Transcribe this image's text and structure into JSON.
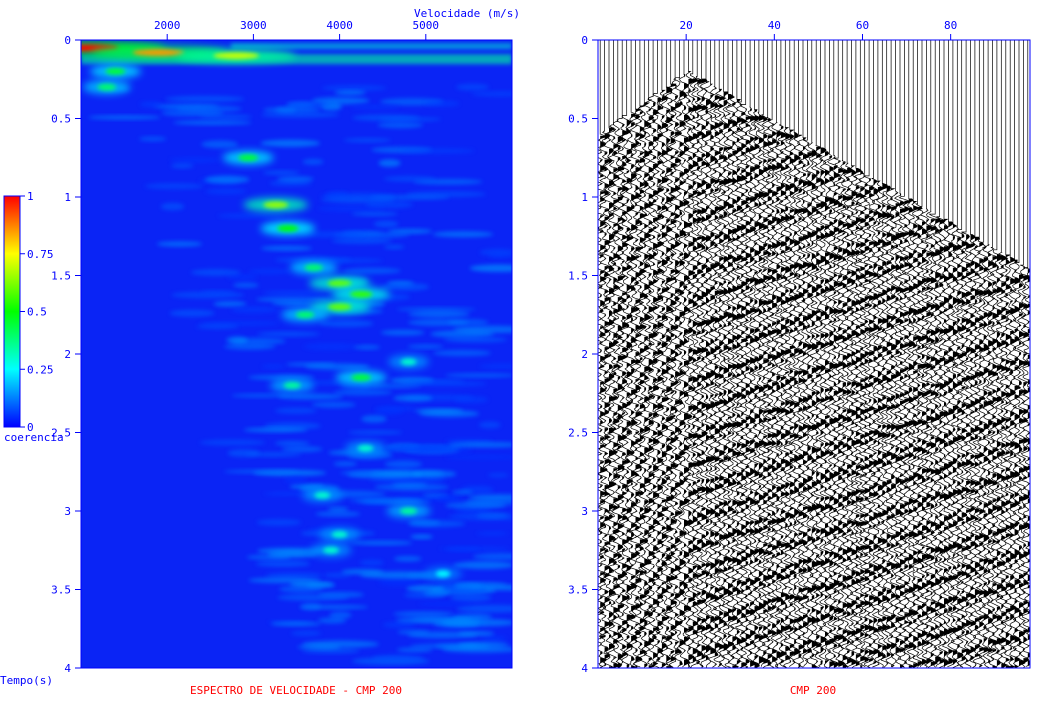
{
  "chart_data": [
    {
      "type": "heatmap",
      "title": "ESPECTRO DE VELOCIDADE - CMP 200",
      "xlabel": "Velocidade (m/s)",
      "ylabel": "Tempo(s)",
      "xlim": [
        1000,
        6000
      ],
      "ylim": [
        0,
        4
      ],
      "x_ticks": [
        "2000",
        "3000",
        "4000",
        "5000"
      ],
      "y_ticks": [
        "0",
        "0.5",
        "1",
        "1.5",
        "2",
        "2.5",
        "3",
        "3.5",
        "4"
      ],
      "colorbar": {
        "label": "coerencia",
        "range": [
          0,
          1
        ],
        "ticks": [
          "0",
          "0.25",
          "0.5",
          "0.75",
          "1"
        ],
        "colors": [
          "#0000ff",
          "#00ffff",
          "#00ff00",
          "#ffff00",
          "#ff0000"
        ]
      },
      "background_color": "#0a24f5",
      "events": [
        {
          "t": 0.05,
          "v": 1100,
          "coherence": 1.0
        },
        {
          "t": 0.08,
          "v": 1900,
          "coherence": 0.85
        },
        {
          "t": 0.1,
          "v": 2800,
          "coherence": 0.7
        },
        {
          "t": 0.2,
          "v": 1400,
          "coherence": 0.45
        },
        {
          "t": 0.3,
          "v": 1300,
          "coherence": 0.4
        },
        {
          "t": 0.75,
          "v": 2940,
          "coherence": 0.45
        },
        {
          "t": 1.05,
          "v": 3260,
          "coherence": 0.65
        },
        {
          "t": 1.2,
          "v": 3400,
          "coherence": 0.5
        },
        {
          "t": 1.45,
          "v": 3700,
          "coherence": 0.4
        },
        {
          "t": 1.55,
          "v": 4000,
          "coherence": 0.6
        },
        {
          "t": 1.62,
          "v": 4250,
          "coherence": 0.55
        },
        {
          "t": 1.7,
          "v": 4000,
          "coherence": 0.6
        },
        {
          "t": 1.75,
          "v": 3600,
          "coherence": 0.4
        },
        {
          "t": 2.05,
          "v": 4800,
          "coherence": 0.3
        },
        {
          "t": 2.15,
          "v": 4250,
          "coherence": 0.45
        },
        {
          "t": 2.2,
          "v": 3450,
          "coherence": 0.35
        },
        {
          "t": 2.6,
          "v": 4300,
          "coherence": 0.3
        },
        {
          "t": 2.9,
          "v": 3800,
          "coherence": 0.3
        },
        {
          "t": 3.0,
          "v": 4800,
          "coherence": 0.35
        },
        {
          "t": 3.15,
          "v": 4000,
          "coherence": 0.3
        },
        {
          "t": 3.25,
          "v": 3900,
          "coherence": 0.3
        },
        {
          "t": 3.4,
          "v": 5200,
          "coherence": 0.25
        }
      ]
    },
    {
      "type": "wiggle",
      "title": "CMP 200",
      "xlim": [
        0,
        98
      ],
      "ylim": [
        0,
        4
      ],
      "x_ticks": [
        "20",
        "40",
        "60",
        "80"
      ],
      "y_ticks": [
        "0",
        "0.5",
        "1",
        "1.5",
        "2",
        "2.5",
        "3",
        "3.5",
        "4"
      ],
      "apex_trace": 20,
      "apex_time": 0.2,
      "first_break_left_trace": 0,
      "first_break_left_time": 0.6,
      "first_break_right_trace": 97,
      "first_break_right_time": 1.45,
      "trace_color": "#000000"
    }
  ]
}
